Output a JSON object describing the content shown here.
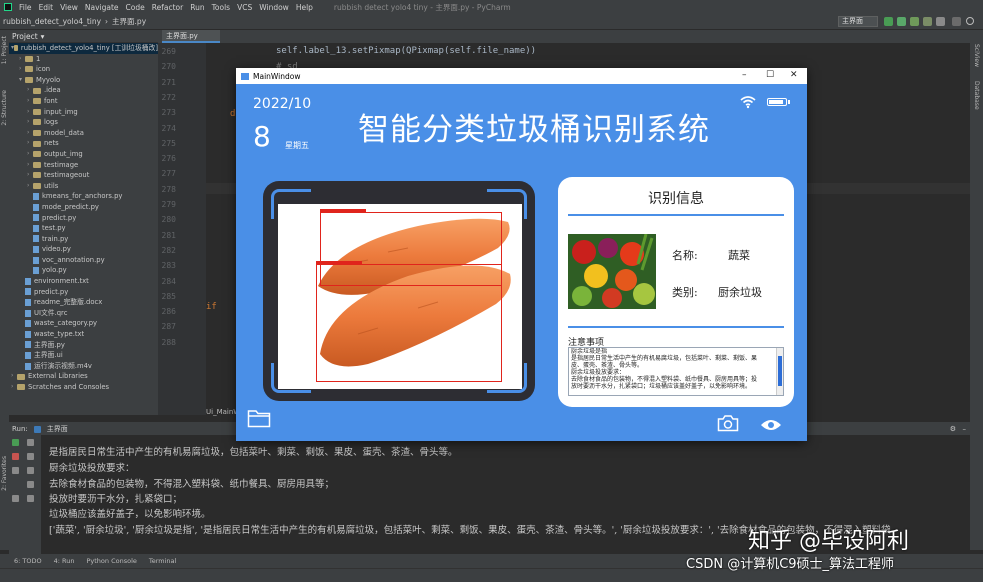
{
  "ide": {
    "menu": [
      "File",
      "Edit",
      "View",
      "Navigate",
      "Code",
      "Refactor",
      "Run",
      "Tools",
      "VCS",
      "Window",
      "Help"
    ],
    "window_title": "rubbish detect yolo4 tiny - 主界面.py - PyCharm",
    "breadcrumb": [
      "rubbish_detect_yolo4_tiny",
      "主界面.py"
    ],
    "run_config": "主界面",
    "project_label": "Project",
    "tree": [
      {
        "label": "rubbish_detect_yolo4_tiny [工训垃圾桶改]",
        "type": "folder",
        "open": true,
        "depth": 0
      },
      {
        "label": "1",
        "type": "folder",
        "depth": 1
      },
      {
        "label": "icon",
        "type": "folder",
        "depth": 1
      },
      {
        "label": "Myyolo",
        "type": "folder",
        "open": true,
        "depth": 1
      },
      {
        "label": ".idea",
        "type": "folder",
        "depth": 2
      },
      {
        "label": "font",
        "type": "folder",
        "depth": 2
      },
      {
        "label": "input_img",
        "type": "folder",
        "depth": 2
      },
      {
        "label": "logs",
        "type": "folder",
        "depth": 2
      },
      {
        "label": "model_data",
        "type": "folder",
        "depth": 2
      },
      {
        "label": "nets",
        "type": "folder",
        "depth": 2
      },
      {
        "label": "output_img",
        "type": "folder",
        "depth": 2
      },
      {
        "label": "testimage",
        "type": "folder",
        "depth": 2
      },
      {
        "label": "testimageout",
        "type": "folder",
        "depth": 2
      },
      {
        "label": "utils",
        "type": "folder",
        "depth": 2
      },
      {
        "label": "kmeans_for_anchors.py",
        "type": "file",
        "depth": 2
      },
      {
        "label": "mode_predict.py",
        "type": "file",
        "depth": 2
      },
      {
        "label": "predict.py",
        "type": "file",
        "depth": 2
      },
      {
        "label": "test.py",
        "type": "file",
        "depth": 2
      },
      {
        "label": "train.py",
        "type": "file",
        "depth": 2
      },
      {
        "label": "video.py",
        "type": "file",
        "depth": 2
      },
      {
        "label": "voc_annotation.py",
        "type": "file",
        "depth": 2
      },
      {
        "label": "yolo.py",
        "type": "file",
        "depth": 2
      },
      {
        "label": "environment.txt",
        "type": "file",
        "depth": 1
      },
      {
        "label": "predict.py",
        "type": "file",
        "depth": 1
      },
      {
        "label": "readme_完整版.docx",
        "type": "file",
        "depth": 1
      },
      {
        "label": "UI文件.qrc",
        "type": "file",
        "depth": 1
      },
      {
        "label": "waste_category.py",
        "type": "file",
        "depth": 1
      },
      {
        "label": "waste_type.txt",
        "type": "file",
        "depth": 1
      },
      {
        "label": "主界面.py",
        "type": "file",
        "depth": 1
      },
      {
        "label": "主界面.ui",
        "type": "file",
        "depth": 1
      },
      {
        "label": "运行演示视频.m4v",
        "type": "file",
        "depth": 1
      },
      {
        "label": "External Libraries",
        "type": "folder",
        "depth": 0
      },
      {
        "label": "Scratches and Consoles",
        "type": "folder",
        "depth": 0
      }
    ],
    "editor_tab": "主界面.py",
    "line_numbers": [
      "269",
      "270",
      "271",
      "272",
      "273",
      "274",
      "275",
      "276",
      "277",
      "278",
      "279",
      "280",
      "281",
      "282",
      "283",
      "284",
      "285",
      "286",
      "287",
      "288"
    ],
    "code_lines": {
      "l269": "self.label_13.setPixmap(QPixmap(self.file_name))",
      "l270": "# sd",
      "l273": "d",
      "l286": "if"
    },
    "ui_tab_fragment": "Ui_MainWin",
    "run_label": "Run:",
    "run_tab": "主界面",
    "output_lines": [
      "是指居民日常生活中产生的有机易腐垃圾，包括菜叶、剩菜、剩饭、果皮、蛋壳、茶渣、骨头等。",
      "厨余垃圾投放要求：",
      "去除食材食品的包装物，不得混入塑料袋、纸巾餐具、厨房用具等；",
      "投放时要沥干水分，扎紧袋口；",
      "垃圾桶应该盖好盖子，以免影响环境。",
      "['蔬菜', '厨余垃圾', '厨余垃圾是指', '是指居民日常生活中产生的有机易腐垃圾，包括菜叶、剩菜、剩饭、果皮、蛋壳、茶渣、骨头等。', '厨余垃圾投放要求：', '去除食材食品的包装物，不得混入塑料袋、"
    ],
    "bottom_tabs": [
      "6: TODO",
      "4: Run",
      "Python Console",
      "Terminal"
    ],
    "left_vertical": [
      "1: Project",
      "2: Structure",
      "2: Favorites"
    ],
    "right_vertical": [
      "SciView",
      "Database"
    ]
  },
  "app": {
    "window_title": "MainWindow",
    "date": "2022/10",
    "day": "8",
    "weekday": "星期五",
    "title": "智能分类垃圾桶识别系统",
    "info_title": "识别信息",
    "name_label": "名称:",
    "name_value": "蔬菜",
    "category_label": "类别:",
    "category_value": "厨余垃圾",
    "notes_label": "注意事项",
    "notes": [
      "厨余垃圾是指",
      "是指居民日常生活中产生的有机易腐垃圾，包括菜叶、剩菜、剩饭、果",
      "皮、蛋壳、茶渣、骨头等。",
      "厨余垃圾投放要求：",
      "去除食材食品的包装物，不得混入塑料袋、纸巾餐具、厨房用具等；投",
      "放时要沥干水分，扎紧袋口；垃圾桶应该盖好盖子，以免影响环境。"
    ]
  },
  "watermark": {
    "line1": "知乎 @毕设阿利",
    "line2": "CSDN @计算机C9硕士_算法工程师"
  },
  "colors": {
    "app_blue": "#4a8fe7",
    "frame_dark": "#2d2d33",
    "detection_red": "#e0241c",
    "ide_bg": "#2b2b2b",
    "ide_panel": "#3c3f41"
  }
}
